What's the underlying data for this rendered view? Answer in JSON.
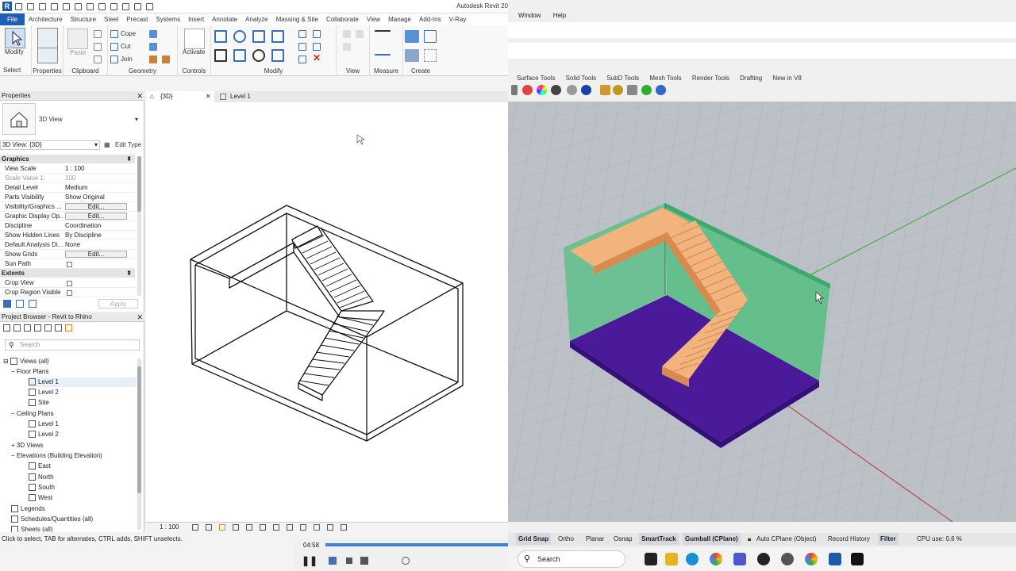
{
  "revit": {
    "title": "Autodesk Revit 20",
    "tabs": [
      "File",
      "Architecture",
      "Structure",
      "Steel",
      "Precast",
      "Systems",
      "Insert",
      "Annotate",
      "Analyze",
      "Massing & Site",
      "Collaborate",
      "View",
      "Manage",
      "Add-Ins",
      "V-Ray"
    ],
    "ribbon": {
      "modify_label": "Modify",
      "select_label": "Select",
      "properties_label": "Properties",
      "clipboard_label": "Clipboard",
      "geometry_label": "Geometry",
      "cope_label": "Cope",
      "cut_label": "Cut",
      "join_label": "Join",
      "paste_label": "Paste",
      "activate_label": "Activate",
      "controls_label": "Controls",
      "modify_group_label": "Modify",
      "view_label": "View",
      "measure_label": "Measure",
      "create_label": "Create"
    },
    "properties": {
      "header": "Properties",
      "type_name": "3D View",
      "selector": "3D View: {3D}",
      "edit_type": "Edit Type",
      "section_graphics": "Graphics",
      "rows": [
        {
          "k": "View Scale",
          "v": "1 : 100"
        },
        {
          "k": "Scale Value    1:",
          "v": "100"
        },
        {
          "k": "Detail Level",
          "v": "Medium"
        },
        {
          "k": "Parts Visibility",
          "v": "Show Original"
        },
        {
          "k": "Visibility/Graphics ...",
          "v": "Edit..."
        },
        {
          "k": "Graphic Display Op...",
          "v": "Edit..."
        },
        {
          "k": "Discipline",
          "v": "Coordination"
        },
        {
          "k": "Show Hidden Lines",
          "v": "By Discipline"
        },
        {
          "k": "Default Analysis Di...",
          "v": "None"
        },
        {
          "k": "Show Grids",
          "v": "Edit..."
        },
        {
          "k": "Sun Path",
          "v": ""
        }
      ],
      "section_extents": "Extents",
      "extents_rows": [
        {
          "k": "Crop View",
          "v": ""
        },
        {
          "k": "Crop Region Visible",
          "v": ""
        }
      ],
      "apply": "Apply"
    },
    "browser": {
      "header": "Project Browser - Revit to Rhino",
      "search_placeholder": "Search",
      "nodes": [
        "Views (all)",
        "Floor Plans",
        "Level 1",
        "Level 2",
        "Site",
        "Ceiling Plans",
        "Level 1",
        "Level 2",
        "3D Views",
        "Elevations (Building Elevation)",
        "East",
        "North",
        "South",
        "West",
        "Legends",
        "Schedules/Quantities (all)",
        "Sheets (all)"
      ]
    },
    "view_tabs": [
      "{3D}",
      "Level 1"
    ],
    "view_scale": "1 : 100",
    "status": "Click to select, TAB for alternates, CTRL adds, SHIFT unselects.",
    "video_time": "04:58",
    "video_progress": 1.0
  },
  "rhino": {
    "menu": [
      "Window",
      "Help"
    ],
    "tool_tabs": [
      "Surface Tools",
      "Solid Tools",
      "SubD Tools",
      "Mesh Tools",
      "Render Tools",
      "Drafting",
      "New in V8"
    ],
    "status": [
      {
        "label": "Grid Snap",
        "on": true
      },
      {
        "label": "Ortho",
        "on": false
      },
      {
        "label": "Planar",
        "on": false
      },
      {
        "label": "Osnap",
        "on": false
      },
      {
        "label": "SmartTrack",
        "on": true
      },
      {
        "label": "Gumball (CPlane)",
        "on": true
      },
      {
        "label": "Auto CPlane (Object)",
        "on": false
      },
      {
        "label": "Record History",
        "on": false
      },
      {
        "label": "Filter",
        "on": true
      },
      {
        "label": "CPU use: 0.6 %",
        "on": false
      }
    ],
    "taskbar_search": "Search",
    "colors": {
      "wall": "#5fbf8a",
      "floor": "#4a1a9a",
      "stair": "#f3b37c",
      "grid_x": "#b33",
      "grid_y": "#3a3"
    }
  }
}
